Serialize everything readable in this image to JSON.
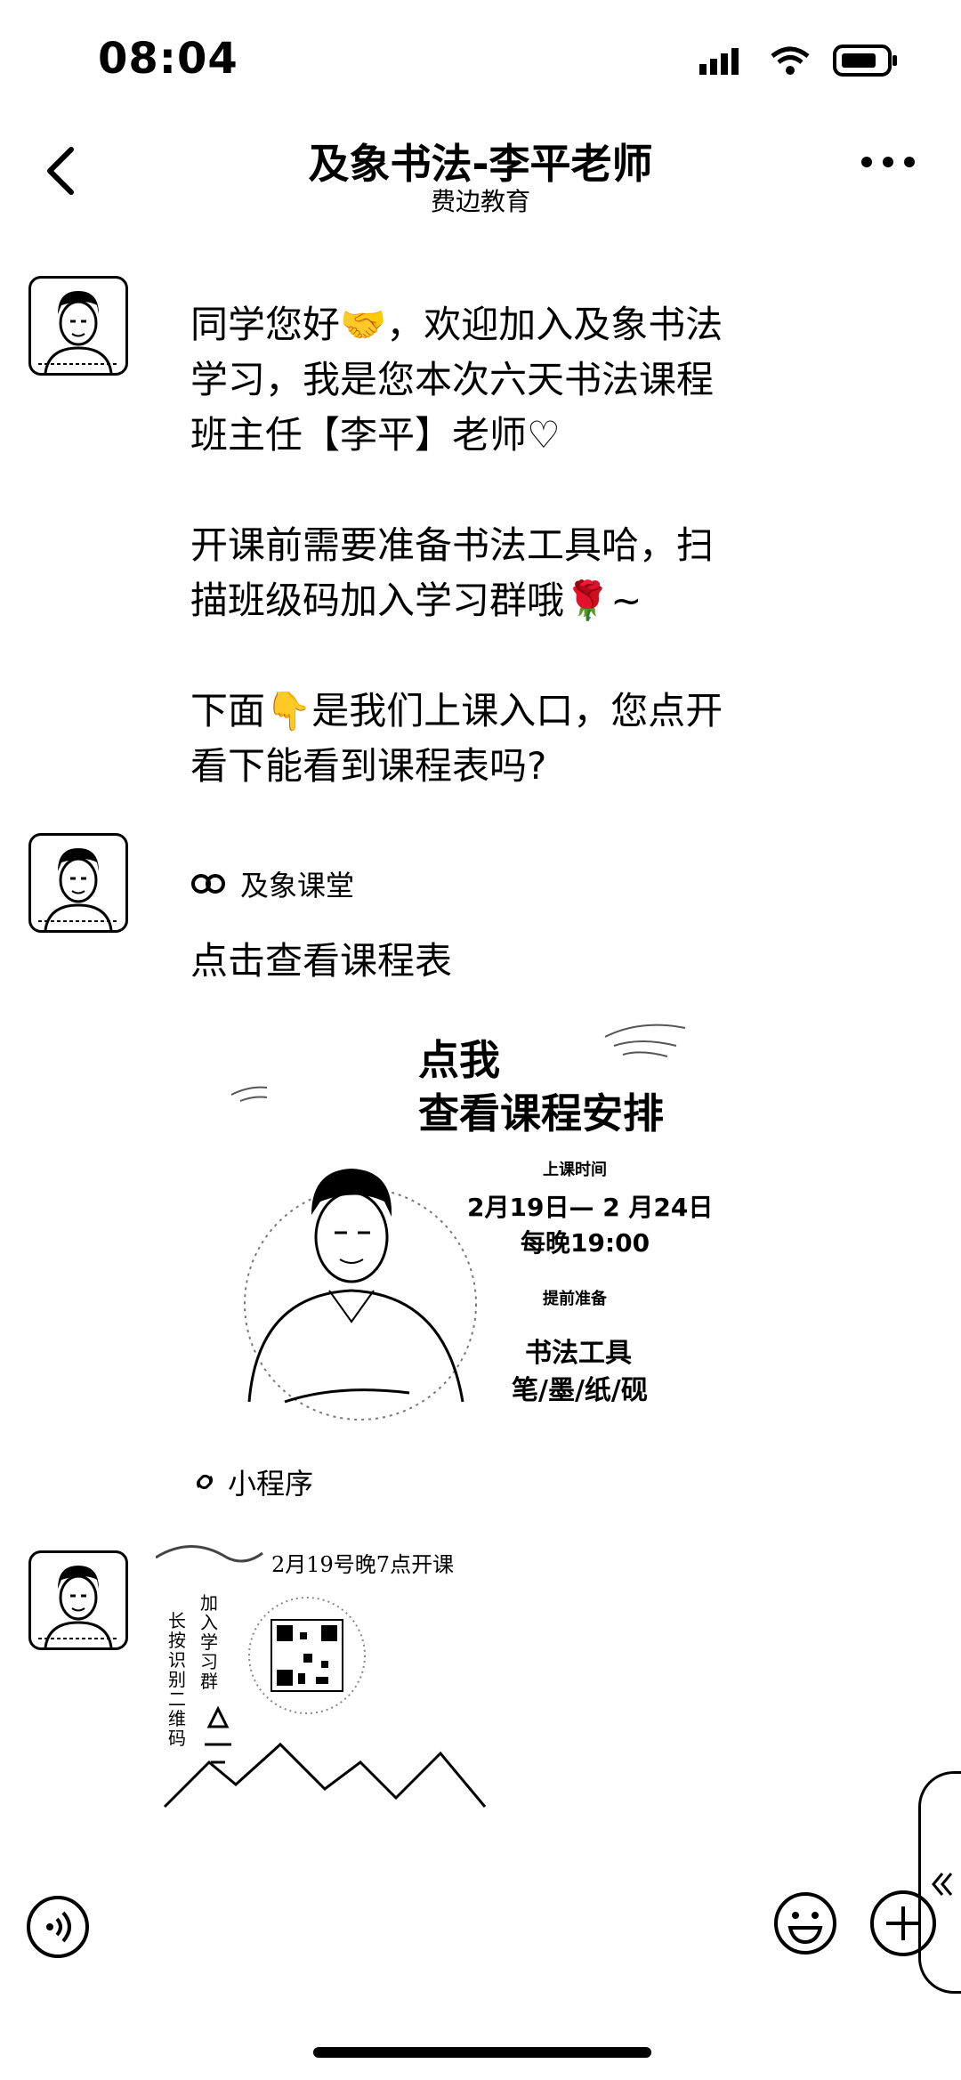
{
  "status": {
    "time": "08:04"
  },
  "header": {
    "title": "及象书法-李平老师",
    "subtitle": "费边教育"
  },
  "messages": {
    "m1": {
      "text": "同学您好🤝，欢迎加入及象书法\n学习，我是您本次六天书法课程\n班主任【李平】老师♡\n\n开课前需要准备书法工具哈，扫\n描班级码加入学习群哦🌹~\n\n下面👇是我们上课入口，您点开\n看下能看到课程表吗?"
    },
    "mini": {
      "source": "及象课堂",
      "title": "点击查看课程表",
      "card": {
        "line1": "点我",
        "line2": "查看课程安排",
        "time_label": "上课时间",
        "dates": "2月19日— 2 月24日",
        "nightly": "每晚19:00",
        "prep_label": "提前准备",
        "tools": "书法工具",
        "tool_list": "笔/墨/纸/砚"
      },
      "footer": "小程序"
    },
    "poster": {
      "headline": "2月19号晚7点开课",
      "vertical_right": "加入学习群",
      "vertical_left": "长按识别二维码"
    }
  }
}
